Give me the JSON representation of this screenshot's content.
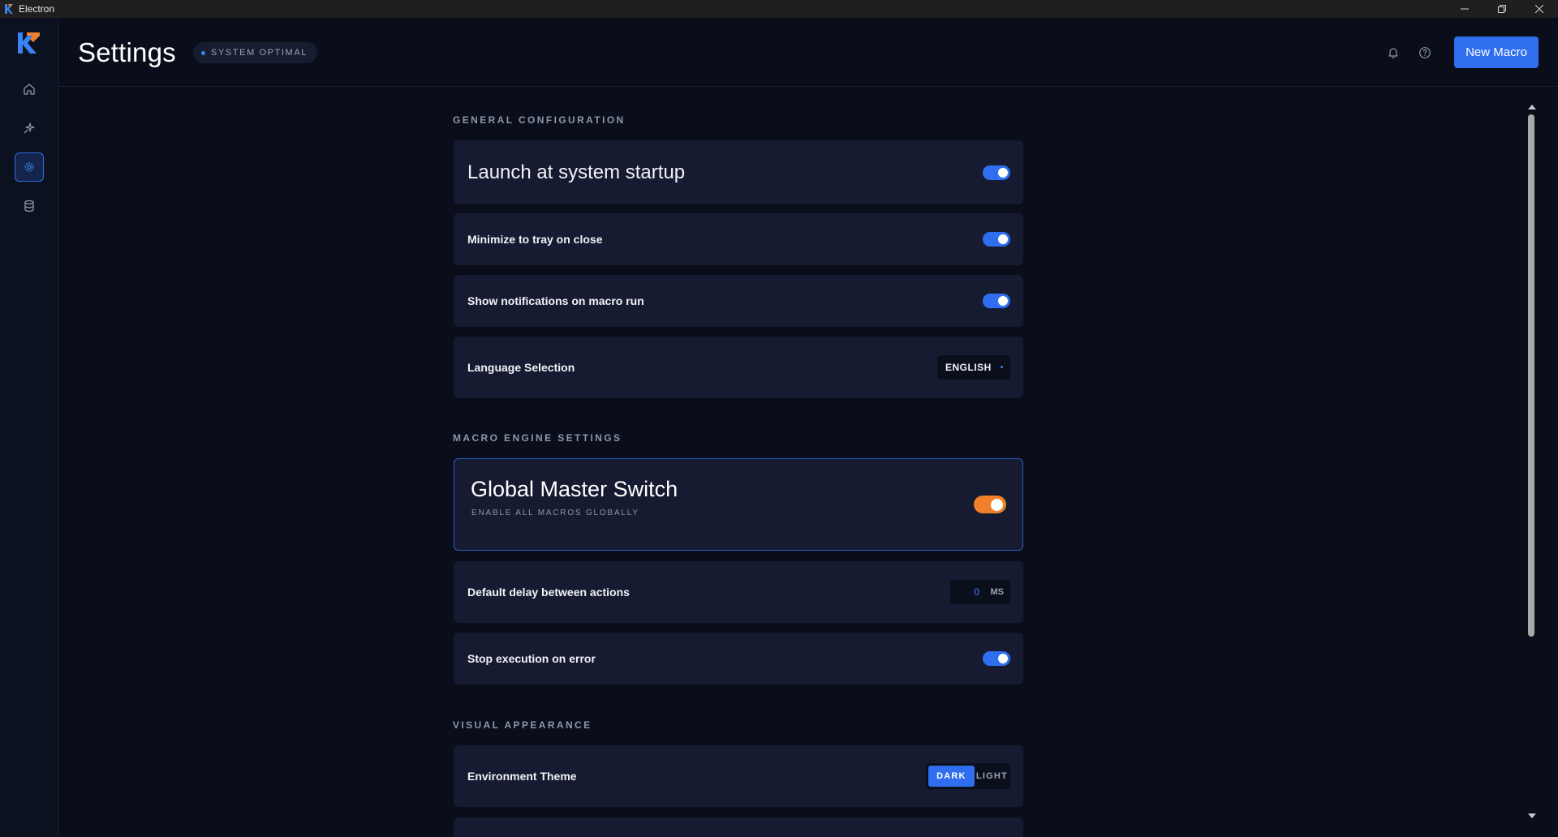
{
  "window": {
    "app_name": "Electron"
  },
  "header": {
    "title": "Settings",
    "status": "SYSTEM OPTIMAL",
    "new_macro_label": "New Macro"
  },
  "sidebar": {
    "items": [
      {
        "icon": "home-icon",
        "active": false
      },
      {
        "icon": "sparkle-icon",
        "active": false
      },
      {
        "icon": "gear-icon",
        "active": true
      },
      {
        "icon": "database-icon",
        "active": false
      }
    ]
  },
  "sections": {
    "general": {
      "title": "GENERAL CONFIGURATION",
      "launch_startup": {
        "label": "Launch at system startup",
        "enabled": true
      },
      "minimize_tray": {
        "label": "Minimize to tray on close",
        "enabled": true
      },
      "notifications": {
        "label": "Show notifications on macro run",
        "enabled": true
      },
      "language": {
        "label": "Language Selection",
        "value": "ENGLISH"
      }
    },
    "engine": {
      "title": "MACRO ENGINE SETTINGS",
      "master": {
        "title": "Global Master Switch",
        "subtitle": "ENABLE ALL MACROS GLOBALLY",
        "enabled": true
      },
      "delay": {
        "label": "Default delay between actions",
        "value": "0",
        "unit": "MS"
      },
      "stop_on_error": {
        "label": "Stop execution on error",
        "enabled": true
      }
    },
    "appearance": {
      "title": "VISUAL APPEARANCE",
      "theme": {
        "label": "Environment Theme",
        "options": [
          "DARK",
          "LIGHT"
        ],
        "selected": "DARK"
      }
    }
  },
  "colors": {
    "accent": "#2f6fef",
    "master_toggle": "#f0812a",
    "card_bg": "#161b31",
    "page_bg": "#0a0e1a"
  }
}
